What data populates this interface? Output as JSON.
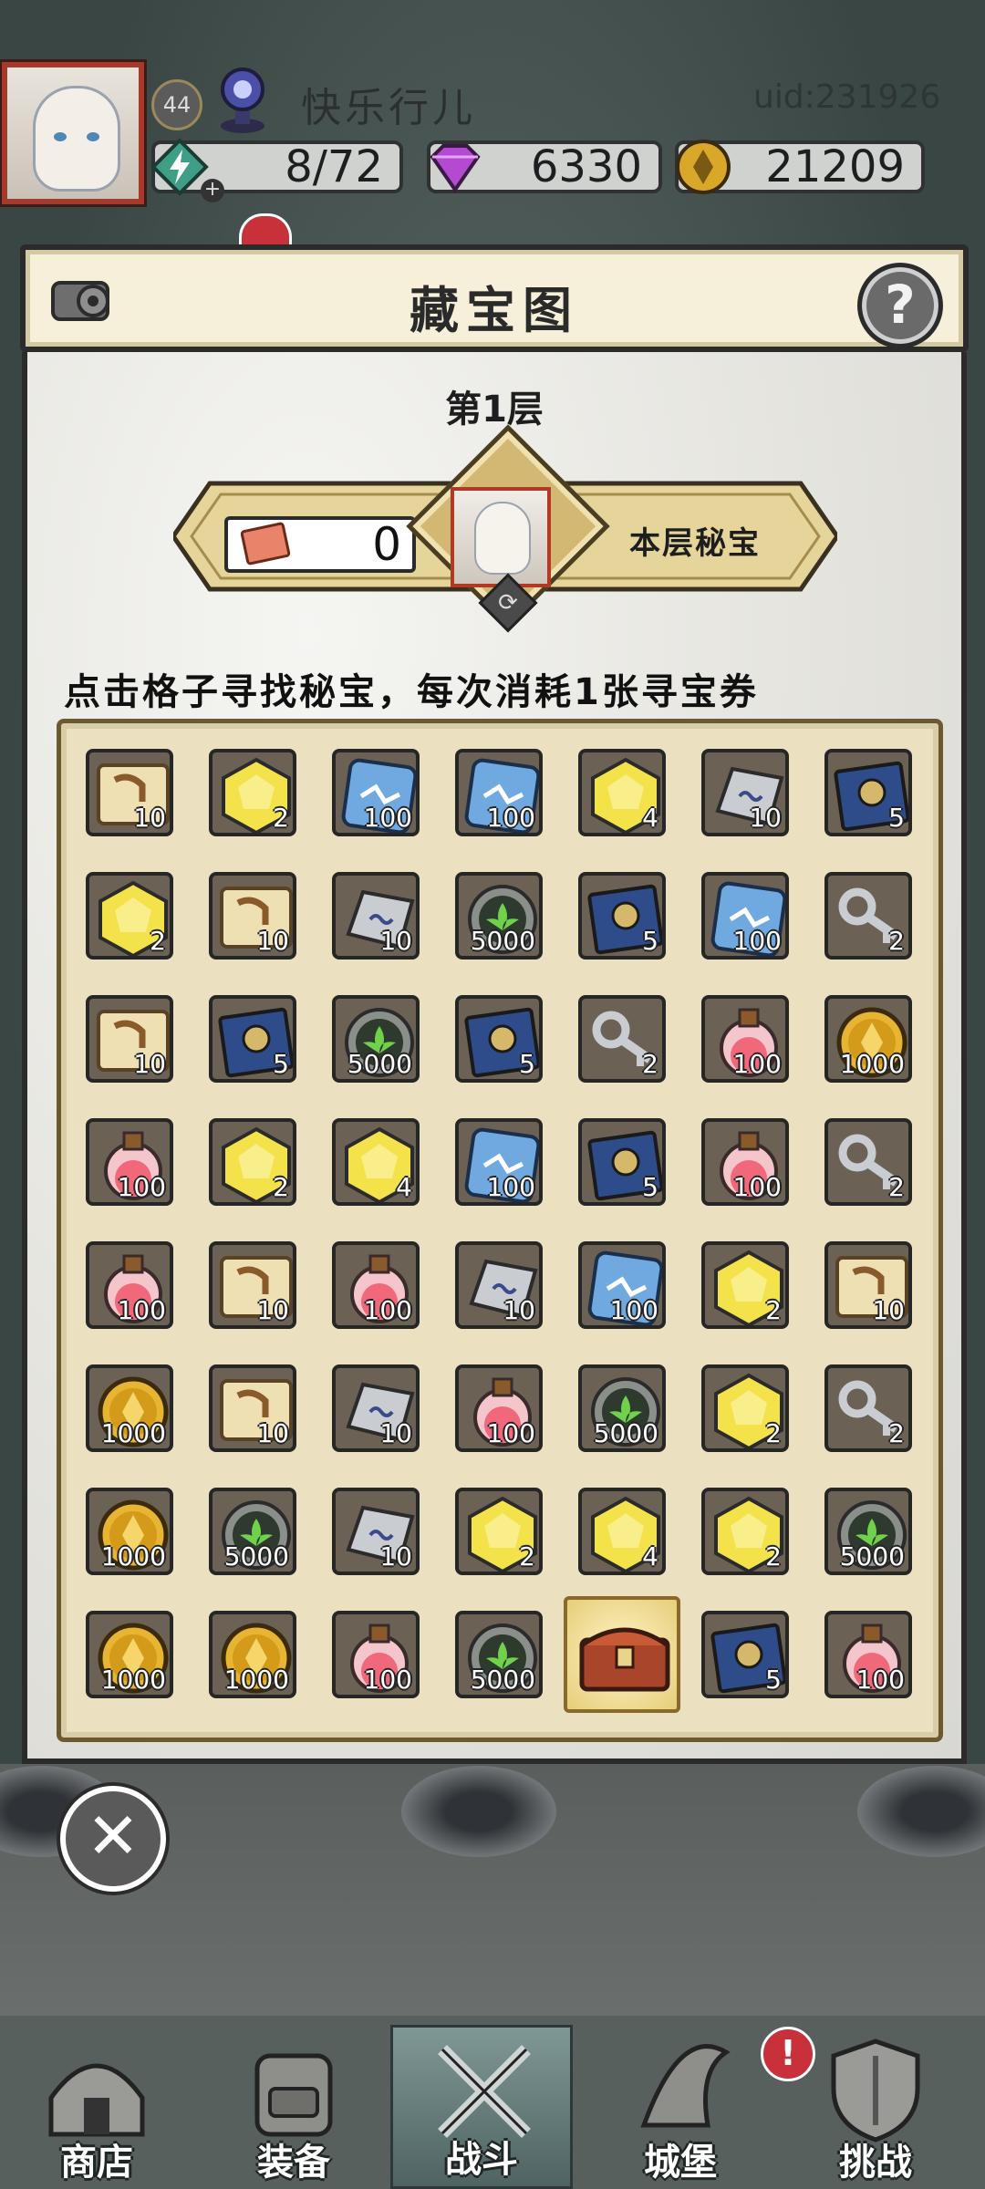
{
  "player": {
    "level": "44",
    "name": "快乐行儿",
    "uid": "uid:231926"
  },
  "resources": {
    "energy": "8/72",
    "gems": "6330",
    "gold": "21209"
  },
  "dialog": {
    "title": "藏宝图",
    "help": "?",
    "floor": "第1层",
    "tickets": "0",
    "secret_label": "本层秘宝",
    "instruction": "点击格子寻找秘宝，每次消耗1张寻宝券"
  },
  "grid": [
    [
      {
        "item": "map-scroll",
        "count": "10"
      },
      {
        "item": "yellow-hex-gem",
        "count": "2"
      },
      {
        "item": "blue-crystal",
        "count": "100"
      },
      {
        "item": "blue-crystal",
        "count": "100"
      },
      {
        "item": "yellow-hex-gem",
        "count": "4"
      },
      {
        "item": "silver-ingot",
        "count": "10"
      },
      {
        "item": "spell-book",
        "count": "5"
      }
    ],
    [
      {
        "item": "yellow-hex-gem",
        "count": "2"
      },
      {
        "item": "map-scroll",
        "count": "10"
      },
      {
        "item": "silver-ingot",
        "count": "10"
      },
      {
        "item": "green-leaf-orb",
        "count": "5000"
      },
      {
        "item": "spell-book",
        "count": "5"
      },
      {
        "item": "blue-crystal",
        "count": "100"
      },
      {
        "item": "silver-key",
        "count": "2"
      }
    ],
    [
      {
        "item": "map-scroll",
        "count": "10"
      },
      {
        "item": "spell-book",
        "count": "5"
      },
      {
        "item": "green-leaf-orb",
        "count": "5000"
      },
      {
        "item": "spell-book",
        "count": "5"
      },
      {
        "item": "silver-key",
        "count": "2"
      },
      {
        "item": "potion",
        "count": "100"
      },
      {
        "item": "gold-coin",
        "count": "1000"
      }
    ],
    [
      {
        "item": "potion",
        "count": "100"
      },
      {
        "item": "yellow-hex-gem",
        "count": "2"
      },
      {
        "item": "yellow-hex-gem",
        "count": "4"
      },
      {
        "item": "blue-crystal",
        "count": "100"
      },
      {
        "item": "spell-book",
        "count": "5"
      },
      {
        "item": "potion",
        "count": "100"
      },
      {
        "item": "silver-key",
        "count": "2"
      }
    ],
    [
      {
        "item": "potion",
        "count": "100"
      },
      {
        "item": "map-scroll",
        "count": "10"
      },
      {
        "item": "potion",
        "count": "100"
      },
      {
        "item": "silver-ingot",
        "count": "10"
      },
      {
        "item": "blue-crystal",
        "count": "100"
      },
      {
        "item": "yellow-hex-gem",
        "count": "2"
      },
      {
        "item": "map-scroll",
        "count": "10"
      }
    ],
    [
      {
        "item": "gold-coin",
        "count": "1000"
      },
      {
        "item": "map-scroll",
        "count": "10"
      },
      {
        "item": "silver-ingot",
        "count": "10"
      },
      {
        "item": "potion",
        "count": "100"
      },
      {
        "item": "green-leaf-orb",
        "count": "5000"
      },
      {
        "item": "yellow-hex-gem",
        "count": "2"
      },
      {
        "item": "silver-key",
        "count": "2"
      }
    ],
    [
      {
        "item": "gold-coin",
        "count": "1000"
      },
      {
        "item": "green-leaf-orb",
        "count": "5000"
      },
      {
        "item": "silver-ingot",
        "count": "10"
      },
      {
        "item": "yellow-hex-gem",
        "count": "2"
      },
      {
        "item": "yellow-hex-gem",
        "count": "4"
      },
      {
        "item": "yellow-hex-gem",
        "count": "2"
      },
      {
        "item": "green-leaf-orb",
        "count": "5000"
      }
    ],
    [
      {
        "item": "gold-coin",
        "count": "1000"
      },
      {
        "item": "gold-coin",
        "count": "1000"
      },
      {
        "item": "potion",
        "count": "100"
      },
      {
        "item": "green-leaf-orb",
        "count": "5000"
      },
      {
        "item": "treasure-chest",
        "count": ""
      },
      {
        "item": "spell-book",
        "count": "5"
      },
      {
        "item": "potion",
        "count": "100"
      }
    ]
  ],
  "nav": [
    {
      "label": "商店",
      "icon": "shop-house-icon"
    },
    {
      "label": "装备",
      "icon": "backpack-icon"
    },
    {
      "label": "战斗",
      "icon": "crossed-swords-icon"
    },
    {
      "label": "城堡",
      "icon": "castle-hat-icon"
    },
    {
      "label": "挑战",
      "icon": "shield-icon"
    }
  ],
  "nav_badge": "!",
  "colors": {
    "panel_border": "#2b2b2b",
    "gold": "#e7b531",
    "accent_red": "#c8303a"
  }
}
